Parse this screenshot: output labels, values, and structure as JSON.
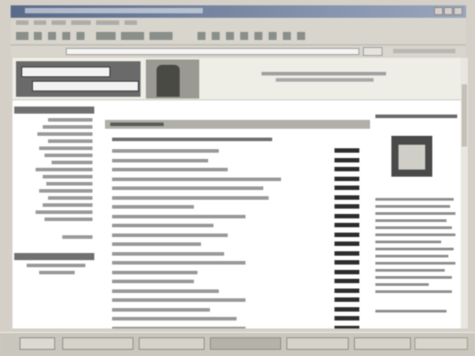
{
  "browser": {
    "title": "",
    "menu_items": [
      "",
      "",
      "",
      "",
      "",
      ""
    ],
    "address": "",
    "go_label": "",
    "links_label": ""
  },
  "site": {
    "logo_text": "",
    "header_info": ""
  },
  "leftnav": {
    "heading": "",
    "links": []
  },
  "content": {
    "title": "",
    "section_heading": "",
    "rows": []
  },
  "rightbar": {
    "heading": ""
  },
  "taskbar": {
    "start_label": "",
    "buttons": []
  }
}
